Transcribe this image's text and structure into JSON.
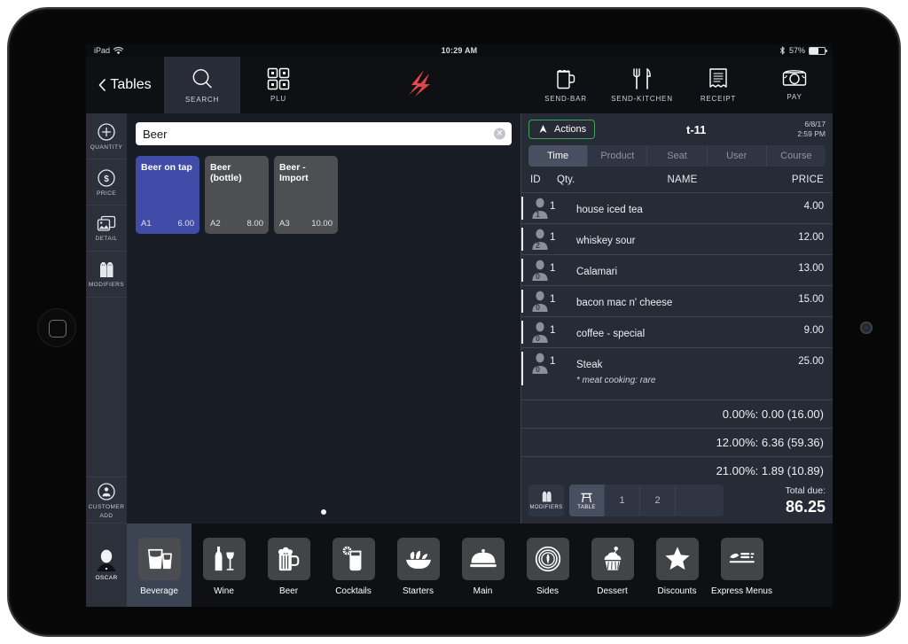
{
  "status_bar": {
    "device": "iPad",
    "wifi_icon": "wifi-icon",
    "time": "10:29 AM",
    "bluetooth_icon": "bluetooth-icon",
    "battery_percent": "57%",
    "battery_level": 57
  },
  "toolbar": {
    "back_label": "Tables",
    "back_icon": "chevron-left-icon",
    "items": [
      {
        "label": "SEARCH",
        "icon": "search-icon",
        "active": true
      },
      {
        "label": "PLU",
        "icon": "grid-icon",
        "active": false
      },
      {
        "label": "SEND-BAR",
        "icon": "beer-mug-icon",
        "active": false
      },
      {
        "label": "SEND-KITCHEN",
        "icon": "fork-knife-icon",
        "active": false
      },
      {
        "label": "RECEIPT",
        "icon": "receipt-icon",
        "active": false
      },
      {
        "label": "PAY",
        "icon": "cash-icon",
        "active": false
      }
    ],
    "logo": "lightspeed-logo",
    "logo_color": "#e8484f"
  },
  "rail": {
    "items": [
      {
        "label": "QUANTITY",
        "icon": "plus-circle-icon"
      },
      {
        "label": "PRICE",
        "icon": "dollar-circle-icon"
      },
      {
        "label": "DETAIL",
        "icon": "detail-images-icon"
      },
      {
        "label": "MODIFIERS",
        "icon": "modifiers-icon"
      }
    ],
    "customer_add_label": "CUSTOMER\nADD",
    "customer_add_line1": "CUSTOMER",
    "customer_add_line2": "ADD",
    "customer_add_icon": "person-circle-icon",
    "user_name": "OSCAR",
    "user_icon": "waiter-avatar-icon"
  },
  "search": {
    "value": "Beer",
    "placeholder": "Search",
    "clear_icon": "clear-circle-icon"
  },
  "products": {
    "tiles": [
      {
        "name": "Beer on tap",
        "code": "A1",
        "price": "6.00",
        "selected": true
      },
      {
        "name": "Beer (bottle)",
        "code": "A2",
        "price": "8.00",
        "selected": false
      },
      {
        "name": "Beer - Import",
        "code": "A3",
        "price": "10.00",
        "selected": false
      }
    ],
    "selected_color": "#414ba8",
    "page_dots": 1
  },
  "order": {
    "actions_label": "Actions",
    "actions_icon": "actions-icon",
    "table_name": "t-11",
    "date": "6/8/17",
    "time": "2:59 PM",
    "segments": [
      {
        "label": "Time",
        "active": true
      },
      {
        "label": "Product",
        "active": false
      },
      {
        "label": "Seat",
        "active": false
      },
      {
        "label": "User",
        "active": false
      },
      {
        "label": "Course",
        "active": false
      }
    ],
    "columns": {
      "id": "ID",
      "qty": "Qty.",
      "name": "NAME",
      "price": "PRICE"
    },
    "lines": [
      {
        "seat": "1",
        "qty": "1",
        "name": "house iced tea",
        "price": "4.00",
        "note": ""
      },
      {
        "seat": "2",
        "qty": "1",
        "name": "whiskey sour",
        "price": "12.00",
        "note": ""
      },
      {
        "seat": "0",
        "qty": "1",
        "name": "Calamari",
        "price": "13.00",
        "note": ""
      },
      {
        "seat": "0",
        "qty": "1",
        "name": "bacon mac n' cheese",
        "price": "15.00",
        "note": ""
      },
      {
        "seat": "0",
        "qty": "1",
        "name": "coffee - special",
        "price": "9.00",
        "note": ""
      },
      {
        "seat": "0",
        "qty": "1",
        "name": "Steak",
        "price": "25.00",
        "note": "* meat cooking: rare"
      }
    ],
    "taxes": [
      "0.00%: 0.00 (16.00)",
      "12.00%: 6.36 (59.36)",
      "21.00%: 1.89 (10.89)"
    ],
    "footer_buttons": [
      {
        "label": "MODIFIERS",
        "icon": "modifiers-icon",
        "active": false,
        "type": "button"
      },
      {
        "label": "TABLE",
        "icon": "table-icon",
        "active": true,
        "type": "group"
      },
      {
        "label": "1",
        "icon": "",
        "active": false,
        "type": "group"
      },
      {
        "label": "2",
        "icon": "",
        "active": false,
        "type": "group"
      },
      {
        "label": "",
        "icon": "",
        "active": false,
        "type": "group"
      }
    ],
    "total_label": "Total due:",
    "total_value": "86.25"
  },
  "categories": [
    {
      "label": "Beverage",
      "icon": "glasses-icon",
      "active": true
    },
    {
      "label": "Wine",
      "icon": "wine-bottle-glass-icon",
      "active": false
    },
    {
      "label": "Beer",
      "icon": "beer-mug-icon",
      "active": false
    },
    {
      "label": "Cocktails",
      "icon": "cocktail-glass-icon",
      "active": false
    },
    {
      "label": "Starters",
      "icon": "salad-bowl-icon",
      "active": false
    },
    {
      "label": "Main",
      "icon": "cloche-icon",
      "active": false
    },
    {
      "label": "Sides",
      "icon": "side-dish-icon",
      "active": false
    },
    {
      "label": "Dessert",
      "icon": "cupcake-icon",
      "active": false
    },
    {
      "label": "Discounts",
      "icon": "star-icon",
      "active": false
    },
    {
      "label": "Express Menus",
      "icon": "express-menu-icon",
      "active": false
    }
  ]
}
